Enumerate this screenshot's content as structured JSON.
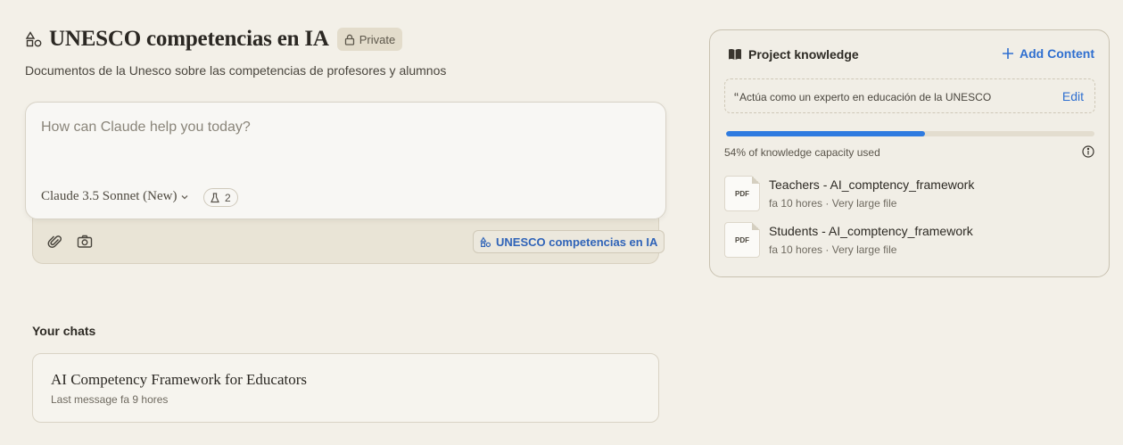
{
  "project": {
    "title": "UNESCO competencias en IA",
    "private_label": "Private",
    "description": "Documentos de la Unesco sobre las competencias de profesores y alumnos",
    "icon": "project-shapes-icon"
  },
  "composer": {
    "placeholder": "How can Claude help you today?",
    "model_label": "Claude 3.5 Sonnet (New)",
    "tools_count": "2",
    "project_chip_label": "UNESCO competencias en IA",
    "icons": [
      "paperclip-icon",
      "camera-icon",
      "beaker-icon",
      "chevron-down-icon"
    ]
  },
  "chats": {
    "heading": "Your chats",
    "items": [
      {
        "title": "AI Competency Framework for Educators",
        "meta": "Last message fa 9 hores"
      }
    ]
  },
  "knowledge": {
    "title": "Project knowledge",
    "add_label": "Add Content",
    "instructions_quote": "“",
    "instructions": "Actúa como un experto en educación de la UNESCO",
    "edit_label": "Edit",
    "capacity_fraction": 0.54,
    "capacity_text": "54% of knowledge capacity used",
    "files": [
      {
        "badge": "PDF",
        "name": "Teachers - AI_comptency_framework",
        "age": "fa 10 hores",
        "dot": "·",
        "size": "Very large file"
      },
      {
        "badge": "PDF",
        "name": "Students - AI_comptency_framework",
        "age": "fa 10 hores",
        "dot": "·",
        "size": "Very large file"
      }
    ]
  },
  "colors": {
    "background": "#f3f0e8",
    "accent": "#2f6fd0",
    "progress": "#2f7be0"
  }
}
